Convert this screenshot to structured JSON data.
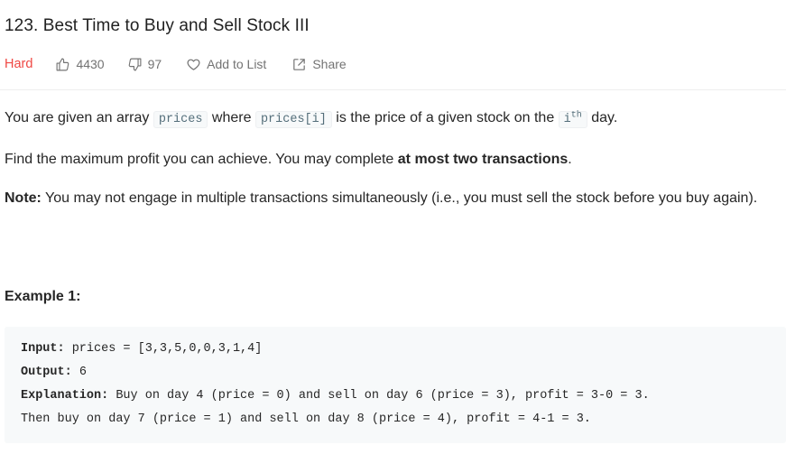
{
  "problem": {
    "title": "123. Best Time to Buy and Sell Stock III",
    "difficulty": "Hard",
    "likes": "4430",
    "dislikes": "97",
    "add_to_list": "Add to List",
    "share": "Share"
  },
  "description": {
    "p1_a": "You are given an array ",
    "p1_code1": "prices",
    "p1_b": " where ",
    "p1_code2": "prices[i]",
    "p1_c": " is the price of a given stock on the ",
    "p1_code3": "i",
    "p1_sup": "th",
    "p1_d": " day.",
    "p2_a": "Find the maximum profit you can achieve. You may complete ",
    "p2_bold": "at most two transactions",
    "p2_b": ".",
    "p3_bold": "Note:",
    "p3_text": " You may not engage in multiple transactions simultaneously (i.e., you must sell the stock before you buy again)."
  },
  "example": {
    "title": "Example 1:",
    "input_label": "Input:",
    "input_value": " prices = [3,3,5,0,0,3,1,4]",
    "output_label": "Output:",
    "output_value": " 6",
    "explanation_label": "Explanation:",
    "explanation_value": " Buy on day 4 (price = 0) and sell on day 6 (price = 3), profit = 3-0 = 3.",
    "explanation_line2": "Then buy on day 7 (price = 1) and sell on day 8 (price = 4), profit = 4-1 = 3."
  },
  "colors": {
    "difficulty_hard": "#ef4743",
    "meta_text": "#737373",
    "code_text": "#546e7a",
    "code_bg": "#f7f9fa"
  },
  "icons": {
    "likes": "thumbs-up-icon",
    "dislikes": "thumbs-down-icon",
    "add_to_list": "heart-icon",
    "share": "share-icon"
  }
}
